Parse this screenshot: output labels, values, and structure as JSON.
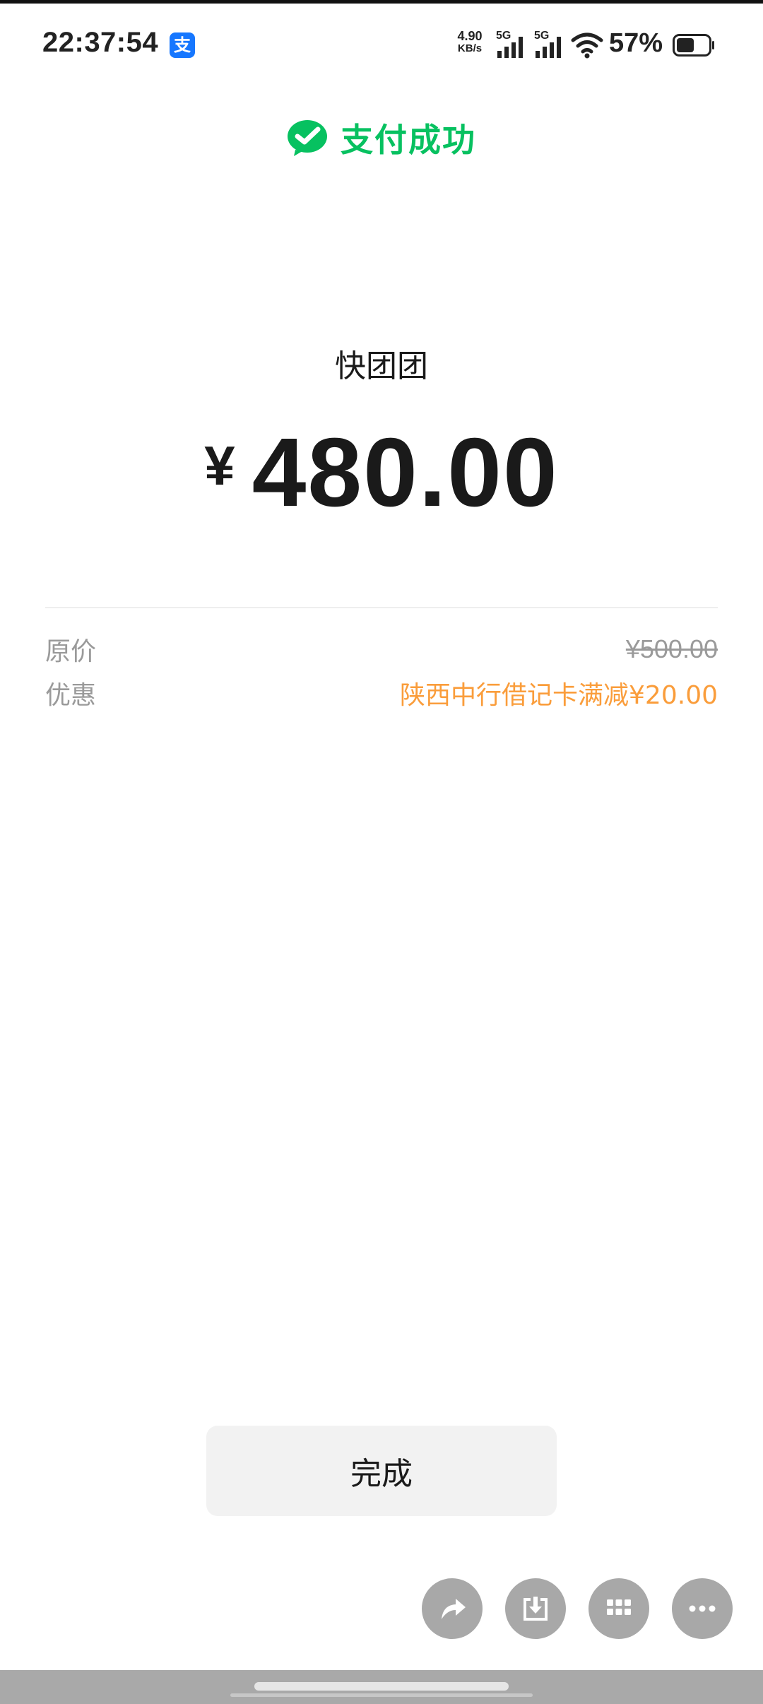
{
  "status_bar": {
    "time": "22:37:54",
    "app_icon_glyph": "支",
    "net_speed_value": "4.90",
    "net_speed_unit": "KB/s",
    "signal_1_label": "5G",
    "signal_2_label": "5G",
    "battery_percent": "57%",
    "battery_level": 0.57
  },
  "header": {
    "title": "支付成功",
    "icon": "wechat-pay-check-icon",
    "accent_color": "#07c160"
  },
  "payment": {
    "merchant": "快团团",
    "currency_symbol": "¥",
    "amount": "480.00"
  },
  "details": [
    {
      "label": "原价",
      "value": "¥500.00"
    },
    {
      "label": "优惠",
      "value": "陕西中行借记卡满减¥20.00"
    }
  ],
  "colors": {
    "discount": "#fa9d3b",
    "fab": "#a8a8a8"
  },
  "done_button": {
    "label": "完成"
  },
  "fabs": [
    {
      "icon": "share-icon"
    },
    {
      "icon": "download-icon"
    },
    {
      "icon": "grid-icon"
    },
    {
      "icon": "more-icon"
    }
  ]
}
